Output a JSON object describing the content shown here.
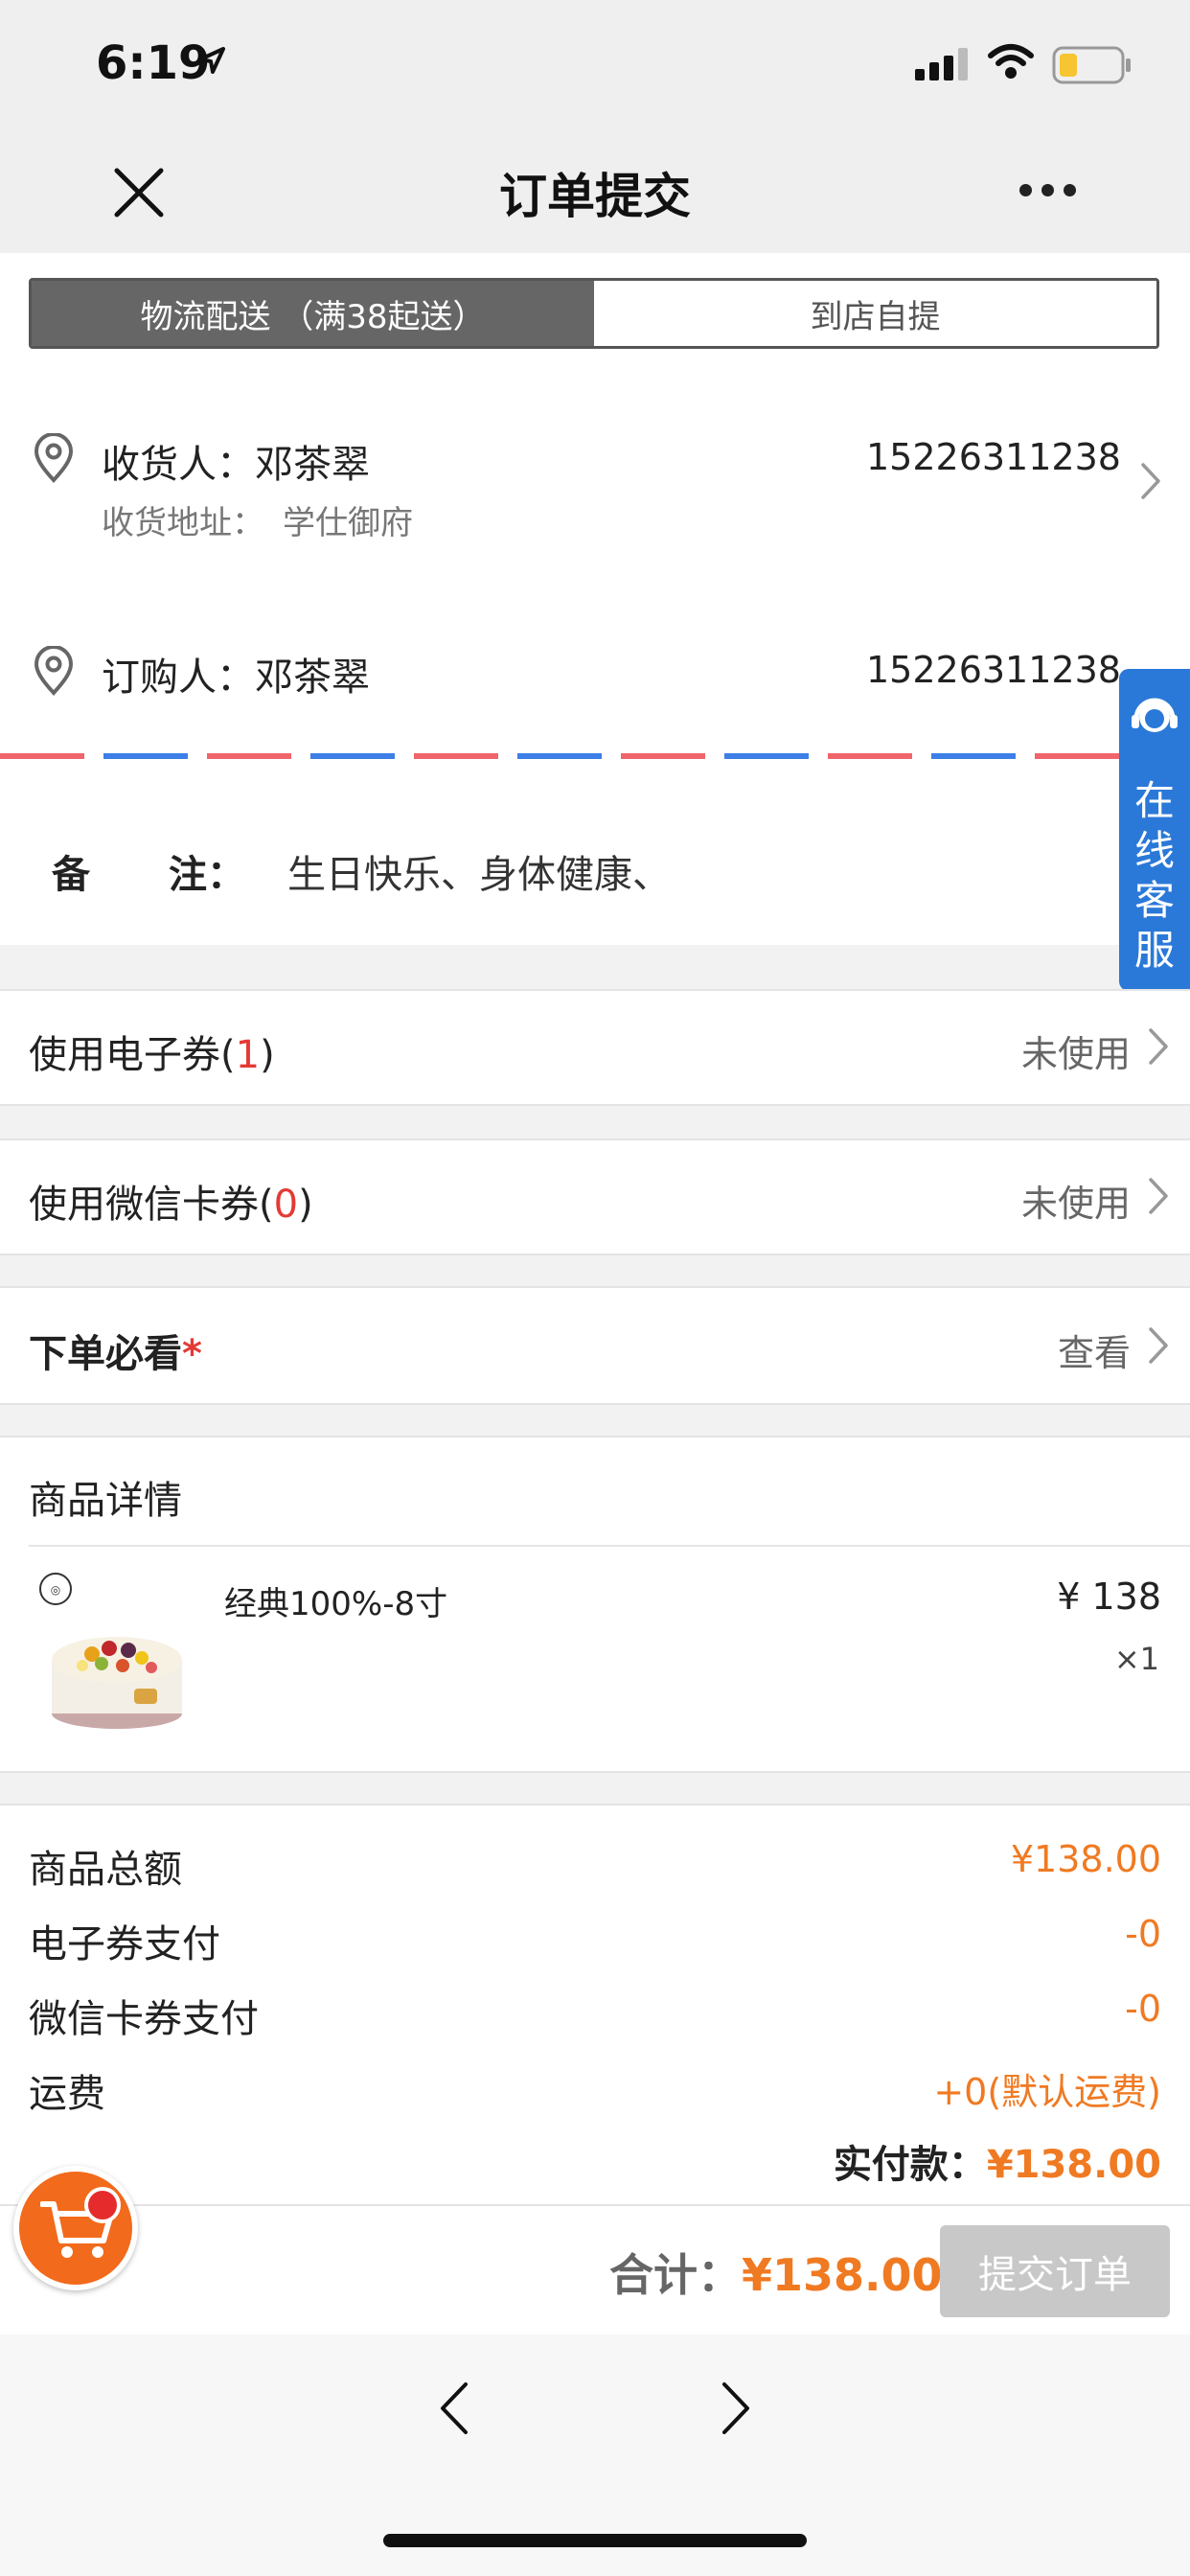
{
  "status_bar": {
    "time": "6:19"
  },
  "header": {
    "title": "订单提交"
  },
  "delivery_tabs": [
    {
      "label": "物流配送 （满38起送）",
      "active": true
    },
    {
      "label": "到店自提",
      "active": false
    }
  ],
  "receiver": {
    "name_label": "收货人：邓茶翠",
    "phone": "15226311238",
    "address_label": "收货地址：",
    "address": "学仕御府"
  },
  "orderer": {
    "name_label": "订购人：邓茶翠",
    "phone": "15226311238"
  },
  "remark": {
    "label_1": "备",
    "label_2": "注：",
    "value": "生日快乐、身体健康、"
  },
  "online_service": {
    "label": "在线客服"
  },
  "coupons": {
    "ecoupon": {
      "label": "使用电子券(",
      "count": "1",
      "close": ")",
      "status": "未使用"
    },
    "wechat_card": {
      "label": "使用微信卡券(",
      "count": "0",
      "close": ")",
      "status": "未使用"
    }
  },
  "must_read": {
    "label": "下单必看",
    "star": "*",
    "action": "查看"
  },
  "product_section": {
    "title": "商品详情",
    "items": [
      {
        "name": "经典100%-8寸",
        "price": "¥ 138",
        "qty": "×1",
        "image": "fruit-cake"
      }
    ]
  },
  "summary": {
    "rows": [
      {
        "label": "商品总额",
        "value": "¥138.00"
      },
      {
        "label": "电子券支付",
        "value": "-0"
      },
      {
        "label": "微信卡券支付",
        "value": "-0"
      },
      {
        "label": "运费",
        "value": "+0(默认运费)"
      }
    ],
    "actual_label": "实付款：",
    "actual_value": "¥138.00"
  },
  "bottom": {
    "total_label": "合计：",
    "total_value": "¥138.00",
    "submit_label": "提交订单"
  },
  "colors": {
    "accent_orange": "#f07a22",
    "red": "#e53935",
    "service_blue": "#2a79d8"
  }
}
